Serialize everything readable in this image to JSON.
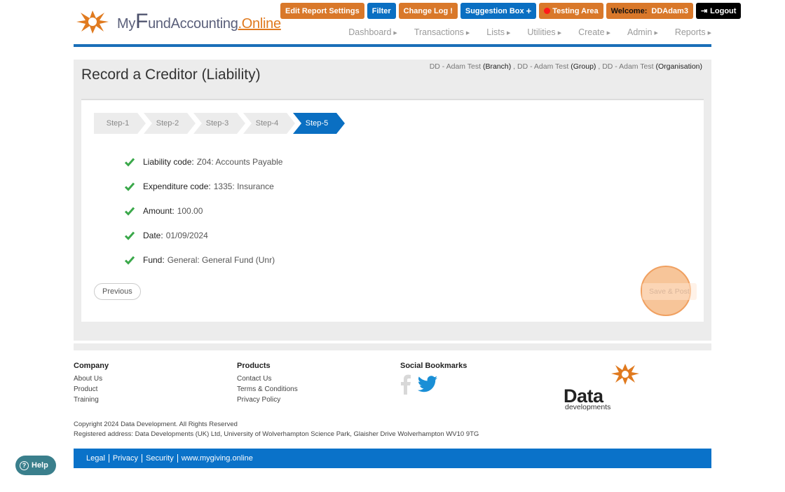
{
  "header": {
    "logo": {
      "prefix": "My",
      "big": "F",
      "rest": "und",
      "accounting": "Accounting",
      "dot_online": ".Online"
    },
    "top_buttons": {
      "edit_report": "Edit Report Settings",
      "filter": "Filter",
      "change_log": "Change Log",
      "suggestion": "Suggestion Box",
      "testing": "Testing Area",
      "welcome": "Welcome:",
      "username": "DDAdam3",
      "logout": "Logout"
    },
    "nav": [
      "Dashboard",
      "Transactions",
      "Lists",
      "Utilities",
      "Create",
      "Admin",
      "Reports"
    ],
    "colors": {
      "orange": "#d9782a",
      "blue": "#0a6fc2",
      "black": "#000000"
    }
  },
  "page": {
    "title": "Record a Creditor (Liability)",
    "breadcrumb": {
      "branch_name": "DD - Adam Test",
      "branch": "(Branch)",
      "sep": ",",
      "group_name": "DD - Adam Test",
      "group": "(Group)",
      "org_name": "DD - Adam Test",
      "org": "(Organisation)"
    },
    "steps": [
      "Step-1",
      "Step-2",
      "Step-3",
      "Step-4",
      "Step-5"
    ],
    "active_step": 5,
    "summary": [
      {
        "label": "Liability code:",
        "value": "Z04: Accounts Payable"
      },
      {
        "label": "Expenditure code:",
        "value": "1335: Insurance"
      },
      {
        "label": "Amount:",
        "value": "100.00"
      },
      {
        "label": "Date:",
        "value": "01/09/2024"
      },
      {
        "label": "Fund:",
        "value": "General: General Fund (Unr)"
      }
    ],
    "previous_label": "Previous",
    "save_label": "Save & Post"
  },
  "footer": {
    "company": {
      "heading": "Company",
      "links": [
        "About Us",
        "Product",
        "Training"
      ]
    },
    "products": {
      "heading": "Products",
      "links": [
        "Contact Us",
        "Terms & Conditions",
        "Privacy Policy"
      ]
    },
    "social": {
      "heading": "Social Bookmarks",
      "icons": [
        "facebook-icon",
        "twitter-icon"
      ]
    },
    "brand": {
      "data": "Data",
      "developments": "developments"
    },
    "copyright": "Copyright 2024 Data Development. All Rights Reserved",
    "address": "Registered address: Data Developments (UK) Ltd, University of Wolverhampton Science Park, Glaisher Drive Wolverhampton WV10 9TG",
    "bar_links": [
      "Legal",
      "Privacy",
      "Security",
      "www.mygiving.online"
    ]
  },
  "help": {
    "label": "Help"
  }
}
